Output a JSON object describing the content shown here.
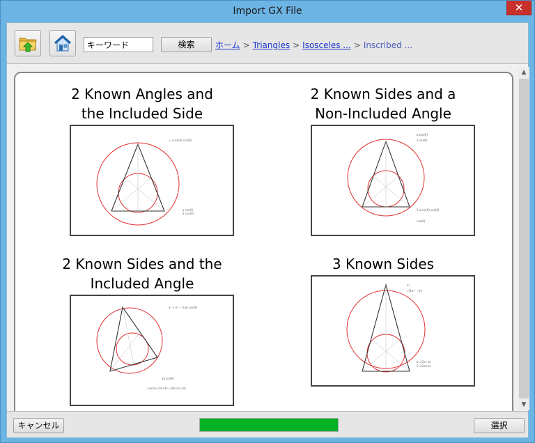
{
  "window": {
    "title": "Import GX File",
    "close_label": "✕"
  },
  "toolbar": {
    "up_folder_icon": "folder-up-icon",
    "home_icon": "home-icon",
    "search_value": "キーワード",
    "search_button_label": "検索"
  },
  "breadcrumb": {
    "items": [
      "ホーム",
      "Triangles",
      "Isosceles ...",
      "Inscribed ..."
    ],
    "separator": ">"
  },
  "cards": [
    {
      "title_line1": "2 Known Angles and",
      "title_line2": "the Included Side"
    },
    {
      "title_line1": "2 Known Sides and a",
      "title_line2": "Non-Included Angle"
    },
    {
      "title_line1": "2 Known Sides and the",
      "title_line2": "Included Angle"
    },
    {
      "title_line1": "3 Known Sides",
      "title_line2": ""
    }
  ],
  "footer": {
    "cancel_label": "キャンセル",
    "select_label": "選択",
    "progress": 1.0
  },
  "colors": {
    "title_bar": "#6cb4e4",
    "close_button": "#c7302b",
    "progress_fill": "#06b025",
    "circle_red": "#e03030",
    "link_blue": "#1a33cc"
  }
}
